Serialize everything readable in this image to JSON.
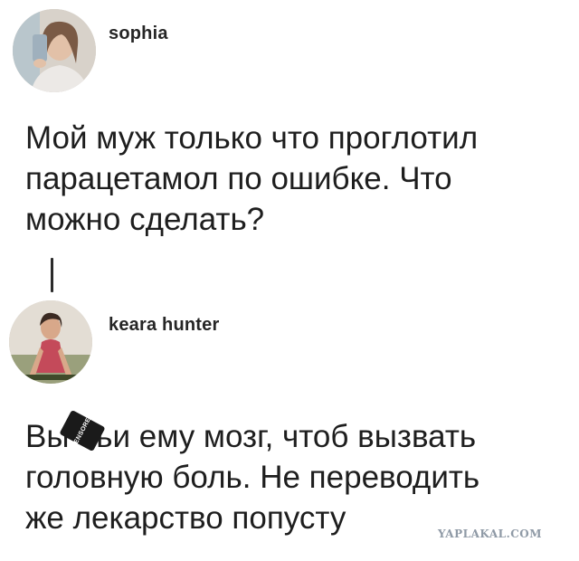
{
  "post1": {
    "username": "sophia",
    "avatar_icon": "user-avatar-icon",
    "text": "Мой муж только что проглотил\nпарацетамол по ошибке. Что\nможно сделать?"
  },
  "post2": {
    "username": "keara hunter",
    "avatar_icon": "user-avatar-icon",
    "text": "Вы бьи ему мозг, чтоб вызвать\nголовную боль. Не переводить\nже лекарство попусту"
  },
  "censor_badge": "CENSORED",
  "watermark": "YAPLAKAL.COM"
}
